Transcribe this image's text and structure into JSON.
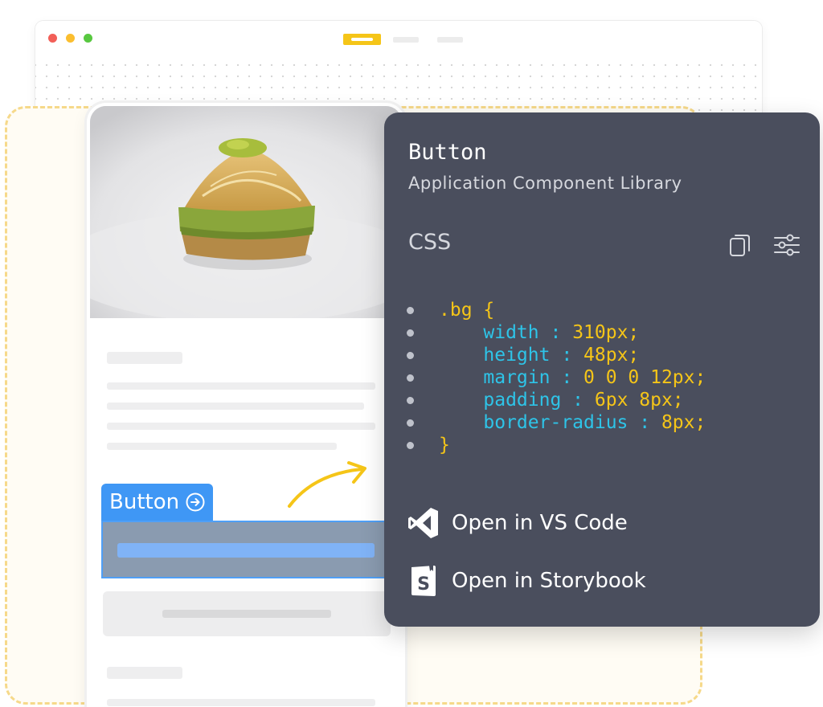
{
  "panel": {
    "title": "Button",
    "subtitle": "Application Component Library",
    "code_language_label": "CSS",
    "toolbar_icons": [
      "copy-icon",
      "settings-sliders-icon"
    ],
    "code_lines": [
      {
        "selector": ".bg {"
      },
      {
        "prop": "width",
        "value": "310px;"
      },
      {
        "prop": "height",
        "value": "48px;"
      },
      {
        "prop": "margin",
        "value": "0 0 0 12px;"
      },
      {
        "prop": "padding",
        "value": "6px 8px;"
      },
      {
        "prop": "border-radius",
        "value": "8px;"
      },
      {
        "selector": "}"
      }
    ],
    "actions": {
      "vscode_label": "Open in VS Code",
      "storybook_label": "Open in Storybook"
    }
  },
  "component_tag": {
    "label": "Button",
    "icon": "arrow-right-circle-icon"
  },
  "colors": {
    "panel_bg": "#4a4e5d",
    "accent_yellow": "#f5c518",
    "code_property": "#2ec4e8",
    "selection_blue": "#3f97f5",
    "traffic_red": "#f25f58",
    "traffic_amber": "#fbbe2f",
    "traffic_green": "#58c840"
  }
}
